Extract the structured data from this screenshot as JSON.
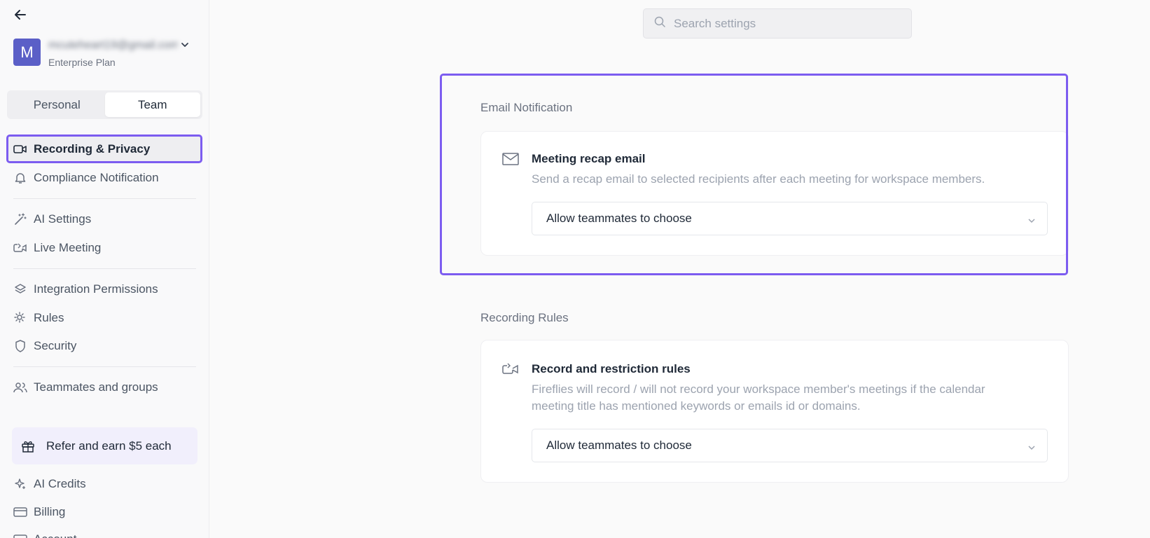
{
  "sidebar": {
    "account": {
      "avatar_letter": "M",
      "email": "mcuteheart19@gmail.com",
      "plan": "Enterprise Plan"
    },
    "tabs": [
      {
        "label": "Personal"
      },
      {
        "label": "Team"
      }
    ],
    "items": [
      {
        "label": "Recording & Privacy",
        "icon": "video-camera-icon"
      },
      {
        "label": "Compliance Notification",
        "icon": "bell-icon"
      },
      {
        "label": "AI Settings",
        "icon": "magic-wand-icon"
      },
      {
        "label": "Live Meeting",
        "icon": "video-forward-icon"
      },
      {
        "label": "Integration Permissions",
        "icon": "layers-icon"
      },
      {
        "label": "Rules",
        "icon": "gear-users-icon"
      },
      {
        "label": "Security",
        "icon": "shield-icon"
      },
      {
        "label": "Teammates and groups",
        "icon": "users-icon"
      },
      {
        "label": "AI Credits",
        "icon": "sparkles-icon"
      },
      {
        "label": "Billing",
        "icon": "credit-card-icon"
      },
      {
        "label": "Account",
        "icon": "account-icon"
      }
    ],
    "refer": {
      "label": "Refer and earn $5 each",
      "icon": "gift-icon"
    }
  },
  "search": {
    "placeholder": "Search settings"
  },
  "sections": {
    "email": {
      "title": "Email Notification",
      "card_title": "Meeting recap email",
      "card_desc": "Send a recap email to selected recipients after each meeting for workspace members.",
      "select_value": "Allow teammates to choose"
    },
    "recording": {
      "title": "Recording Rules",
      "card_title": "Record and restriction rules",
      "card_desc": "Fireflies will record / will not record your workspace member's meetings if the calendar meeting title has mentioned keywords or emails id or domains.",
      "select_value": "Allow teammates to choose"
    }
  },
  "colors": {
    "accent": "#7c5cf0",
    "avatar": "#5b5fc7"
  }
}
